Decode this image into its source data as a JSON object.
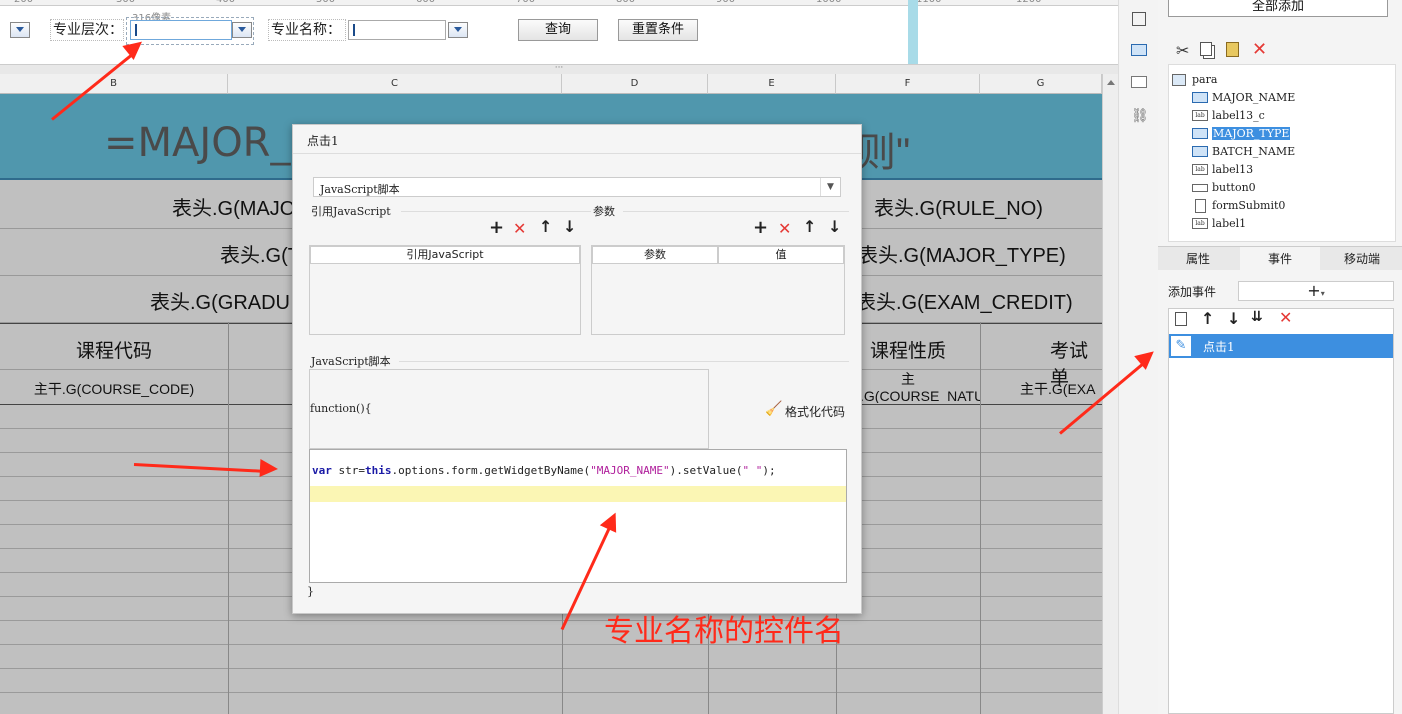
{
  "ruler": {
    "ticks": [
      "200",
      "300",
      "400",
      "500",
      "600",
      "700",
      "800",
      "900",
      "1000",
      "1100",
      "1200"
    ]
  },
  "params": {
    "major_level_label": "专业层次：",
    "major_name_label": "专业名称：",
    "size_hint": "316像素",
    "query_button": "查询",
    "reset_button": "重置条件",
    "divider_glyph": "···"
  },
  "sheet": {
    "columns": [
      "B",
      "C",
      "D",
      "E",
      "F",
      "G"
    ],
    "title_left": "=MAJOR_I",
    "title_right": "则\"",
    "header_rows": [
      {
        "left": "表头.G(MAJO",
        "right": "表头.G(RULE_NO)"
      },
      {
        "left": "表头.G(T",
        "right": "表头.G(MAJOR_TYPE)"
      },
      {
        "left": "表头.G(GRADU",
        "right": "表头.G(EXAM_CREDIT)"
      }
    ],
    "course_code_header": "课程代码",
    "course_nature_header": "课程性质",
    "exam_header": "考试单",
    "course_code_cell": "主干.G(COURSE_CODE)",
    "course_nature_cell": "主干.G(COURSE_NATURE)",
    "exam_cell": "主干.G(EXA"
  },
  "right_panel": {
    "add_all_button": "全部添加",
    "tree": [
      {
        "name": "para",
        "icon": "form-icon"
      },
      {
        "name": "MAJOR_NAME",
        "icon": "dropdown-widget-icon"
      },
      {
        "name": "label13_c",
        "icon": "label-widget-icon"
      },
      {
        "name": "MAJOR_TYPE",
        "icon": "dropdown-widget-icon",
        "selected": true
      },
      {
        "name": "BATCH_NAME",
        "icon": "dropdown-widget-icon"
      },
      {
        "name": "label13",
        "icon": "label-widget-icon"
      },
      {
        "name": "button0",
        "icon": "button-widget-icon"
      },
      {
        "name": "formSubmit0",
        "icon": "submit-widget-icon"
      },
      {
        "name": "label1",
        "icon": "label-widget-icon"
      }
    ],
    "tabs": [
      "属性",
      "事件",
      "移动端"
    ],
    "active_tab": "事件",
    "add_event_label": "添加事件",
    "event_item": "点击1",
    "accent": "#3d8fe0"
  },
  "dialog": {
    "title": "点击1",
    "type_select": "JavaScript脚本",
    "ref_js_section": "引用JavaScript",
    "params_section": "参数",
    "ref_js_col": "引用JavaScript",
    "param_col": "参数",
    "value_col": "值",
    "script_section": "JavaScript脚本",
    "function_open": "function(){",
    "format_code": "格式化代码",
    "code_keyword_var": "var",
    "code_part1": " str=",
    "code_keyword_this": "this",
    "code_part2": ".options.form.getWidgetByName(",
    "code_string": "\"MAJOR_NAME\"",
    "code_part3": ").setValue(",
    "code_string2": "\" \"",
    "code_part4": ");",
    "function_close": "}"
  },
  "annotation": {
    "text": "专业名称的控件名",
    "color": "#ff2a1a"
  }
}
